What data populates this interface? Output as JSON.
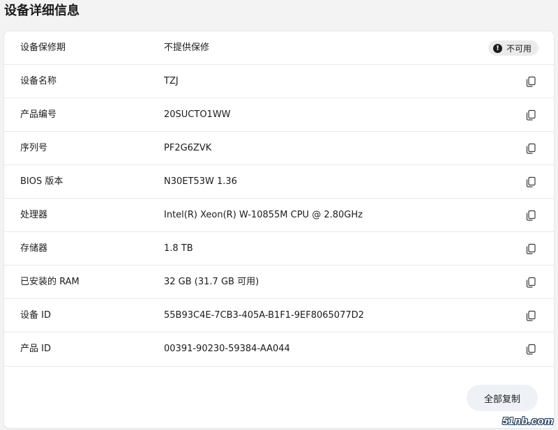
{
  "header": {
    "title": "设备详细信息"
  },
  "warranty": {
    "label": "设备保修期",
    "value": "不提供保修",
    "badge": "不可用",
    "badge_icon": "exclamation-icon"
  },
  "specs": [
    {
      "label": "设备名称",
      "value": "TZJ"
    },
    {
      "label": "产品编号",
      "value": "20SUCTO1WW"
    },
    {
      "label": "序列号",
      "value": "PF2G6ZVK"
    },
    {
      "label": "BIOS 版本",
      "value": "N30ET53W 1.36"
    },
    {
      "label": "处理器",
      "value": "Intel(R) Xeon(R) W-10855M CPU @ 2.80GHz"
    },
    {
      "label": "存储器",
      "value": "1.8 TB"
    },
    {
      "label": "已安装的 RAM",
      "value": "32 GB (31.7 GB 可用)"
    },
    {
      "label": "设备 ID",
      "value": "55B93C4E-7CB3-405A-B1F1-9EF8065077D2"
    },
    {
      "label": "产品 ID",
      "value": "00391-90230-59384-AA044"
    }
  ],
  "actions": {
    "copy_all_label": "全部复制"
  },
  "watermark": "51nb.com",
  "colors": {
    "background": "#f3f3f3",
    "card": "#ffffff",
    "divider": "#e9e9e9",
    "badge_bg": "#ebebeb",
    "button_bg": "#eef1f5"
  }
}
